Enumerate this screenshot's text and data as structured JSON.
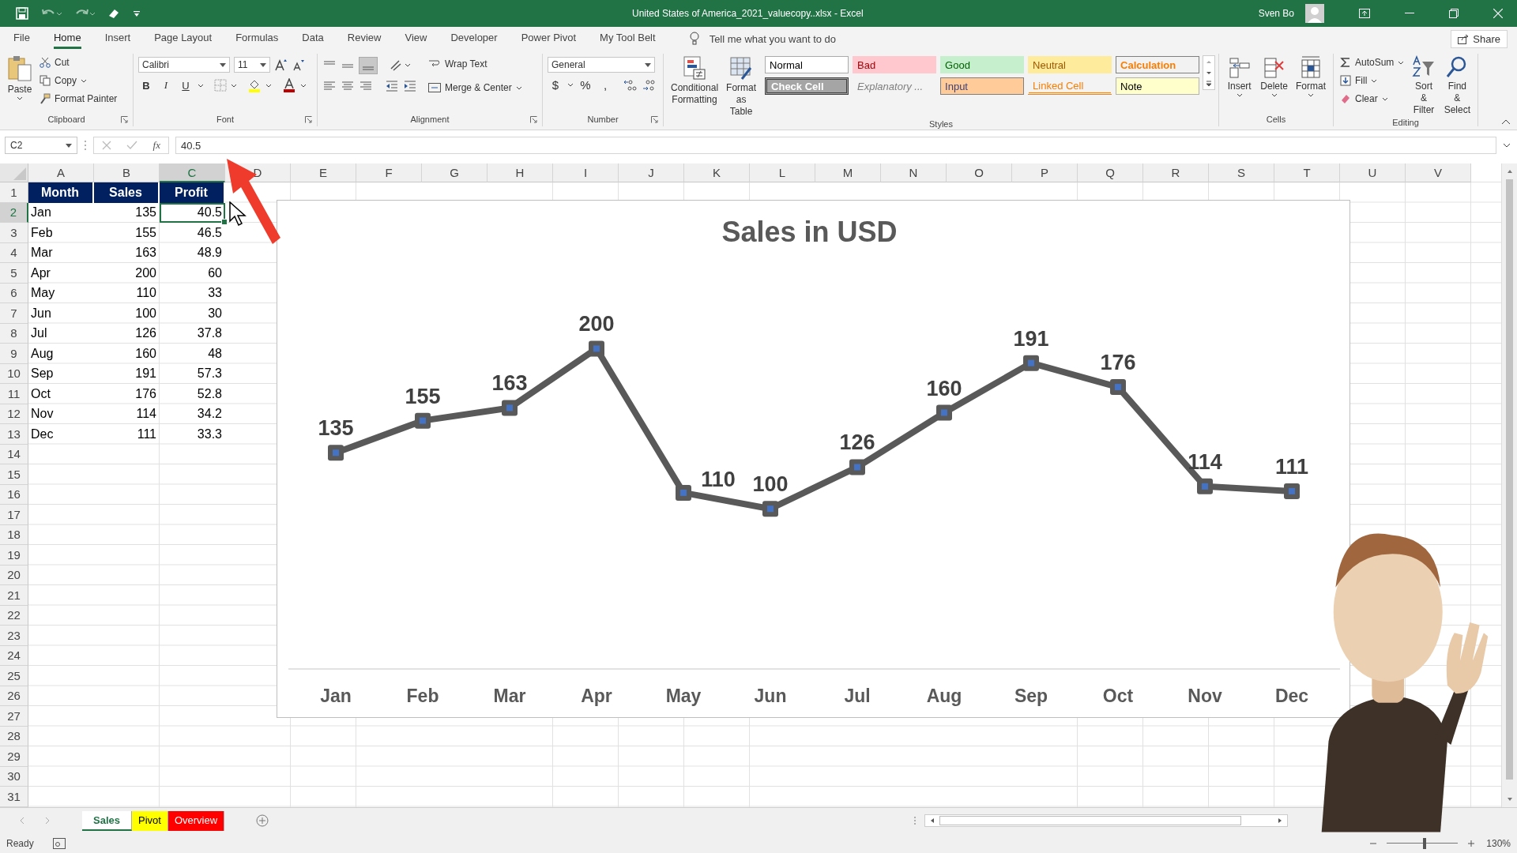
{
  "window": {
    "title": "United States of America_2021_valuecopy..xlsx  -  Excel",
    "user": "Sven Bo"
  },
  "menu_tabs": [
    {
      "label": "File",
      "selected": false
    },
    {
      "label": "Home",
      "selected": true
    },
    {
      "label": "Insert",
      "selected": false
    },
    {
      "label": "Page Layout",
      "selected": false
    },
    {
      "label": "Formulas",
      "selected": false
    },
    {
      "label": "Data",
      "selected": false
    },
    {
      "label": "Review",
      "selected": false
    },
    {
      "label": "View",
      "selected": false
    },
    {
      "label": "Developer",
      "selected": false
    },
    {
      "label": "Power Pivot",
      "selected": false
    },
    {
      "label": "My Tool Belt",
      "selected": false
    }
  ],
  "tell_me": {
    "placeholder": "Tell me what you want to do"
  },
  "share": "Share",
  "clipboard": {
    "paste": "Paste",
    "cut": "Cut",
    "copy": "Copy",
    "format_painter": "Format Painter",
    "label": "Clipboard"
  },
  "font": {
    "name": "Calibri",
    "size": "11",
    "bold": "B",
    "italic": "I",
    "underline": "U",
    "label": "Font"
  },
  "alignment": {
    "wrap_text": "Wrap Text",
    "merge": "Merge & Center",
    "label": "Alignment"
  },
  "number": {
    "format": "General",
    "currency": "$",
    "percent": "%",
    "comma": ",",
    "label": "Number"
  },
  "styles": {
    "conditional": "Conditional Formatting",
    "format_table": "Format as Table",
    "label": "Styles",
    "cell_styles": [
      {
        "label": "Normal",
        "kind": "normal"
      },
      {
        "label": "Bad",
        "kind": "bad"
      },
      {
        "label": "Good",
        "kind": "good"
      },
      {
        "label": "Neutral",
        "kind": "neutral"
      },
      {
        "label": "Calculation",
        "kind": "calculation"
      },
      {
        "label": "Check Cell",
        "kind": "check"
      },
      {
        "label": "Explanatory ...",
        "kind": "explanatory"
      },
      {
        "label": "Input",
        "kind": "input"
      },
      {
        "label": "Linked Cell",
        "kind": "linked"
      },
      {
        "label": "Note",
        "kind": "note"
      }
    ]
  },
  "cells": {
    "insert": "Insert",
    "delete": "Delete",
    "format": "Format",
    "label": "Cells"
  },
  "editing": {
    "autosum": "AutoSum",
    "fill": "Fill",
    "clear": "Clear",
    "sort": "Sort & Filter",
    "find": "Find & Select",
    "label": "Editing"
  },
  "formula_bar": {
    "name_box": "C2",
    "function_label": "fx",
    "value": "40.5"
  },
  "sheet": {
    "columns": [
      {
        "label": "A",
        "selected": false
      },
      {
        "label": "B",
        "selected": false
      },
      {
        "label": "C",
        "selected": true
      },
      {
        "label": "D",
        "selected": false
      },
      {
        "label": "E",
        "selected": false
      },
      {
        "label": "F",
        "selected": false
      },
      {
        "label": "G",
        "selected": false
      },
      {
        "label": "H",
        "selected": false
      },
      {
        "label": "I",
        "selected": false
      },
      {
        "label": "J",
        "selected": false
      },
      {
        "label": "K",
        "selected": false
      },
      {
        "label": "L",
        "selected": false
      },
      {
        "label": "M",
        "selected": false
      },
      {
        "label": "N",
        "selected": false
      },
      {
        "label": "O",
        "selected": false
      },
      {
        "label": "P",
        "selected": false
      },
      {
        "label": "Q",
        "selected": false
      },
      {
        "label": "R",
        "selected": false
      },
      {
        "label": "S",
        "selected": false
      },
      {
        "label": "T",
        "selected": false
      },
      {
        "label": "U",
        "selected": false
      },
      {
        "label": "V",
        "selected": false
      }
    ],
    "row_numbers": [
      "1",
      "2",
      "3",
      "4",
      "5",
      "6",
      "7",
      "8",
      "9",
      "10",
      "11",
      "12",
      "13",
      "14",
      "15",
      "16",
      "17",
      "18",
      "19",
      "20",
      "21",
      "22",
      "23",
      "24",
      "25",
      "26",
      "27",
      "28",
      "29",
      "30",
      "31"
    ],
    "header": [
      "Month",
      "Sales",
      "Profit"
    ],
    "rows": [
      {
        "cells": [
          "Jan",
          "135",
          "40.5"
        ],
        "selected": true
      },
      {
        "cells": [
          "Feb",
          "155",
          "46.5"
        ],
        "selected": false
      },
      {
        "cells": [
          "Mar",
          "163",
          "48.9"
        ],
        "selected": false
      },
      {
        "cells": [
          "Apr",
          "200",
          "60"
        ],
        "selected": false
      },
      {
        "cells": [
          "May",
          "110",
          "33"
        ],
        "selected": false
      },
      {
        "cells": [
          "Jun",
          "100",
          "30"
        ],
        "selected": false
      },
      {
        "cells": [
          "Jul",
          "126",
          "37.8"
        ],
        "selected": false
      },
      {
        "cells": [
          "Aug",
          "160",
          "48"
        ],
        "selected": false
      },
      {
        "cells": [
          "Sep",
          "191",
          "57.3"
        ],
        "selected": false
      },
      {
        "cells": [
          "Oct",
          "176",
          "52.8"
        ],
        "selected": false
      },
      {
        "cells": [
          "Nov",
          "114",
          "34.2"
        ],
        "selected": false
      },
      {
        "cells": [
          "Dec",
          "111",
          "33.3"
        ],
        "selected": false
      }
    ]
  },
  "chart_data": {
    "type": "line",
    "title": "Sales in USD",
    "categories": [
      "Jan",
      "Feb",
      "Mar",
      "Apr",
      "May",
      "Jun",
      "Jul",
      "Aug",
      "Sep",
      "Oct",
      "Nov",
      "Dec"
    ],
    "series": [
      {
        "color": "#595959",
        "marker": "square",
        "values": [
          135,
          155,
          163,
          200,
          110,
          100,
          126,
          160,
          191,
          176,
          114,
          111
        ]
      }
    ],
    "data_labels": true
  },
  "sheet_tabs": [
    {
      "label": "Sales",
      "selected": true
    },
    {
      "label": "Pivot",
      "selected": false,
      "color": "#ffff00"
    },
    {
      "label": "Overview",
      "selected": false,
      "color": "#ff0000"
    }
  ],
  "status_bar": {
    "status": "Ready",
    "zoom": "130%",
    "level": 0.53
  }
}
